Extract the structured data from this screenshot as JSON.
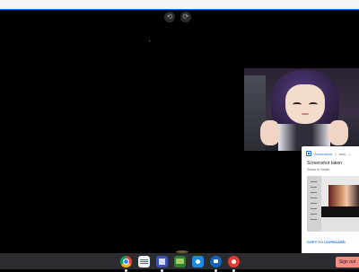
{
  "overlay": {
    "buttons": [
      {
        "name": "rewind-icon",
        "glyph": "⟲"
      },
      {
        "name": "forward-icon",
        "glyph": "⟳"
      }
    ]
  },
  "notification": {
    "app_name": "Screenshot",
    "separator": "•",
    "time": "now",
    "chevron": "⌄",
    "title": "Screenshot taken",
    "subtitle": "Show in folder",
    "action": "COPY TO CLIPBOARD"
  },
  "shelf": {
    "apps": [
      {
        "icon": "chrome-icon",
        "running": true
      },
      {
        "icon": "sheets-icon",
        "running": false
      },
      {
        "icon": "files-icon",
        "running": true
      },
      {
        "icon": "classroom-icon",
        "running": false
      },
      {
        "icon": "camera-icon",
        "running": false
      },
      {
        "icon": "meet-icon",
        "running": true
      },
      {
        "icon": "screen-record-icon",
        "running": true
      }
    ],
    "signout_label": "Sign out"
  },
  "colors": {
    "accent": "#1a73e8",
    "signout_bg": "#f28b82",
    "shelf_bg": "#2a2c2f"
  }
}
